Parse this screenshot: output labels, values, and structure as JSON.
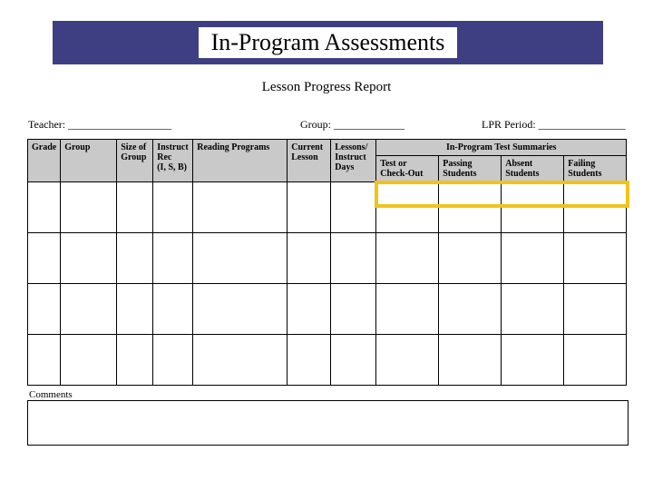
{
  "title": "In-Program Assessments",
  "subtitle": "Lesson Progress Report",
  "fields": {
    "teacher_label": "Teacher: ___________________",
    "group_label": "Group: _____________",
    "period_label": "LPR Period: ________________"
  },
  "columns": {
    "grade": "Grade",
    "group": "Group",
    "size": "Size of Group",
    "instruct": "Instruct Rec\n(I, S, B)",
    "reading": "Reading Programs",
    "current": "Current Lesson",
    "lessons": "Lessons/ Instruct Days",
    "summaries_header": "In-Program Test Summaries",
    "sub": {
      "test": "Test or Check-Out",
      "passing": "Passing Students",
      "absent": "Absent Students",
      "failing": "Failing Students"
    }
  },
  "comments_label": "Comments",
  "chart_data": {
    "type": "table",
    "title": "Lesson Progress Report",
    "columns": [
      "Grade",
      "Group",
      "Size of Group",
      "Instruct Rec (I, S, B)",
      "Reading Programs",
      "Current Lesson",
      "Lessons/ Instruct Days",
      "Test or Check-Out",
      "Passing Students",
      "Absent Students",
      "Failing Students"
    ],
    "rows": [
      [
        "",
        "",
        "",
        "",
        "",
        "",
        "",
        "",
        "",
        "",
        ""
      ],
      [
        "",
        "",
        "",
        "",
        "",
        "",
        "",
        "",
        "",
        "",
        ""
      ],
      [
        "",
        "",
        "",
        "",
        "",
        "",
        "",
        "",
        "",
        "",
        ""
      ],
      [
        "",
        "",
        "",
        "",
        "",
        "",
        "",
        "",
        "",
        "",
        ""
      ]
    ]
  }
}
